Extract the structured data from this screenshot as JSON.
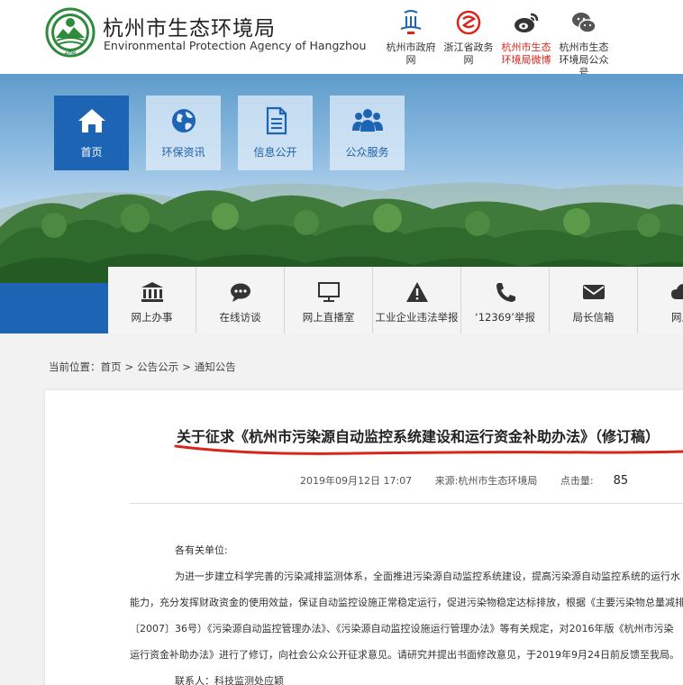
{
  "header": {
    "title_cn": "杭州市生态环境局",
    "title_en": "Environmental Protection Agency of Hangzhou",
    "emblem_text": "ZHB",
    "quick_links": [
      {
        "label": "杭州市政府网",
        "icon": "hangzhou-gov-icon",
        "active": false
      },
      {
        "label": "浙江省政务网",
        "icon": "zhejiang-gov-icon",
        "active": false
      },
      {
        "label": "杭州市生态环境局微博",
        "icon": "weibo-icon",
        "active": true
      },
      {
        "label": "杭州市生态环境局公众号",
        "icon": "wechat-icon",
        "active": false
      }
    ]
  },
  "main_nav": [
    {
      "label": "首页",
      "icon": "home-icon",
      "active": true
    },
    {
      "label": "环保资讯",
      "icon": "globe-icon",
      "active": false
    },
    {
      "label": "信息公开",
      "icon": "document-icon",
      "active": false
    },
    {
      "label": "公众服务",
      "icon": "users-icon",
      "active": false
    }
  ],
  "services": [
    {
      "label": "网上办事",
      "icon": "bank-icon"
    },
    {
      "label": "在线访谈",
      "icon": "chat-icon"
    },
    {
      "label": "网上直播室",
      "icon": "monitor-icon"
    },
    {
      "label": "工业企业违法举报",
      "icon": "warning-icon"
    },
    {
      "label": "‘12369’举报",
      "icon": "phone-icon"
    },
    {
      "label": "局长信箱",
      "icon": "mail-icon"
    },
    {
      "label": "网上",
      "icon": "cloud-icon"
    }
  ],
  "breadcrumb": {
    "prefix": "当前位置：",
    "items": [
      "首页",
      "公告公示",
      "通知公告"
    ],
    "separator": ">"
  },
  "article": {
    "title": "关于征求《杭州市污染源自动监控系统建设和运行资金补助办法》（修订稿）",
    "date": "2019年09月12日 17:07",
    "source": "来源:杭州市生态环境局",
    "hits_label": "点击量:",
    "hits": "85",
    "paragraphs": [
      {
        "text": "各有关单位:",
        "indent": true
      },
      {
        "text": "为进一步建立科学完善的污染减排监测体系，全面推进污染源自动监控系统建设，提高污染源自动监控系统的运行水",
        "indent": true
      },
      {
        "text": "能力，充分发挥财政资金的使用效益，保证自动监控设施正常稳定运行，促进污染物稳定达标排放，根据《主要污染物总量减排",
        "indent": false
      },
      {
        "text": "〔2007〕36号）《污染源自动监控管理办法》、《污染源自动监控设施运行管理办法》等有关规定，对2016年版《杭州市污染",
        "indent": false
      },
      {
        "text": "运行资金补助办法》进行了修订，向社会公众公开征求意见。请研究并提出书面修改意见，于2019年9月24日前反馈至我局。",
        "indent": false
      },
      {
        "text": "联系人：科技监测处应颖",
        "indent": true
      }
    ]
  },
  "colors": {
    "primary_blue": "#1e64b4",
    "accent_red": "#d9261c",
    "emblem_green": "#2e8b3e"
  }
}
